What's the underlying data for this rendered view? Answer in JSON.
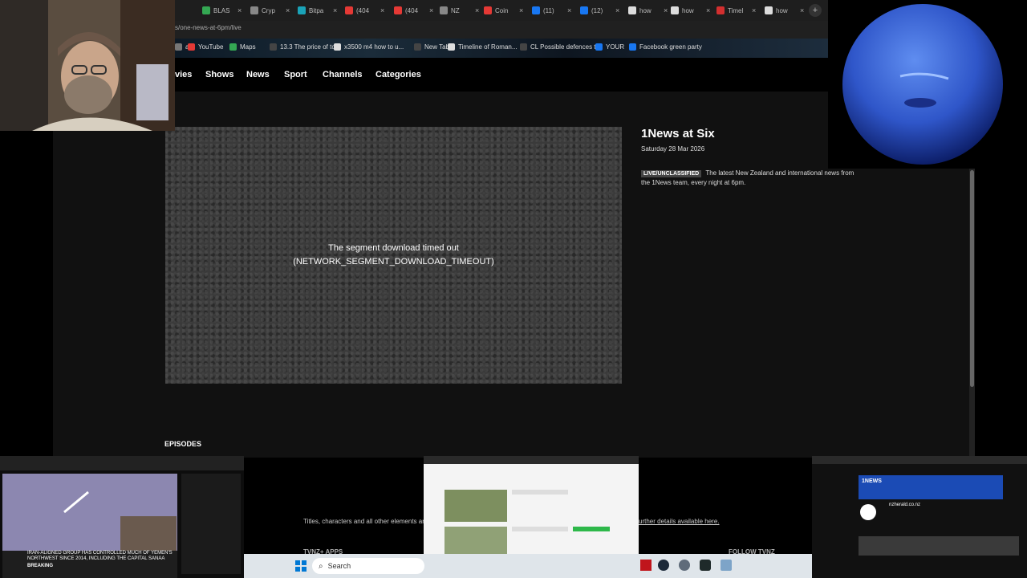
{
  "browser": {
    "tabs": [
      {
        "label": "BLAS",
        "color": "#34a853"
      },
      {
        "label": "Cryp",
        "color": "#888888"
      },
      {
        "label": "Bitpa",
        "color": "#1aa3b8"
      },
      {
        "label": "(404",
        "color": "#e53935"
      },
      {
        "label": "(404",
        "color": "#e53935"
      },
      {
        "label": "NZ",
        "color": "#888888"
      },
      {
        "label": "Coin",
        "color": "#e53935"
      },
      {
        "label": "(11)",
        "color": "#1877f2"
      },
      {
        "label": "(12)",
        "color": "#1877f2"
      },
      {
        "label": "how",
        "color": "#dddddd"
      },
      {
        "label": "how",
        "color": "#dddddd"
      },
      {
        "label": "Timel",
        "color": "#d32f2f"
      },
      {
        "label": "how",
        "color": "#dddddd"
      }
    ],
    "new_tab_symbol": "+",
    "tab_close_symbol": "×",
    "url": "s/one-news-at-6pm/live",
    "bookmarks": [
      {
        "label": "ail",
        "color": "#777777"
      },
      {
        "label": "YouTube",
        "color": "#e53935"
      },
      {
        "label": "Maps",
        "color": "#34a853"
      },
      {
        "label": "13.3 The price of to...",
        "color": "#444444"
      },
      {
        "label": "x3500 m4 how to u...",
        "color": "#dddddd"
      },
      {
        "label": "New Tab",
        "color": "#444444"
      },
      {
        "label": "Timeline of Roman...",
        "color": "#dddddd"
      },
      {
        "label": "CL Possible defences t...",
        "color": "#444444"
      },
      {
        "label": "YOUR",
        "color": "#1877f2"
      },
      {
        "label": "Facebook green party",
        "color": "#1877f2"
      }
    ]
  },
  "nav": {
    "items": [
      "vies",
      "Shows",
      "News",
      "Sport",
      "Channels",
      "Categories"
    ]
  },
  "player": {
    "error_line1": "The segment download timed out",
    "error_line2": "(NETWORK_SEGMENT_DOWNLOAD_TIMEOUT)"
  },
  "show": {
    "title": "1News at Six",
    "date": "Saturday 28 Mar 2026",
    "badge": "LIVE/UNCLASSIFIED",
    "description": "The latest New Zealand and international news from the 1News team, every night at 6pm."
  },
  "episodes_label": "EPISODES",
  "footer": {
    "text_left": "Titles, characters and all other elements are",
    "text_right": "urther details available here.",
    "apps_heading": "TVNZ+ APPS",
    "follow_heading": "FOLLOW TVNZ"
  },
  "taskbar": {
    "search_placeholder": "Search"
  },
  "thumbnails": {
    "left_headline": "IRAN-ALIGNED GROUP HAS CONTROLLED MUCH OF YEMEN'S NORTHWEST SINCE 2014, INCLUDING THE CAPITAL SANAA",
    "left_breaking": "BREAKING",
    "right_site": "nzherald.co.nz",
    "right_banner": "1NEWS"
  }
}
